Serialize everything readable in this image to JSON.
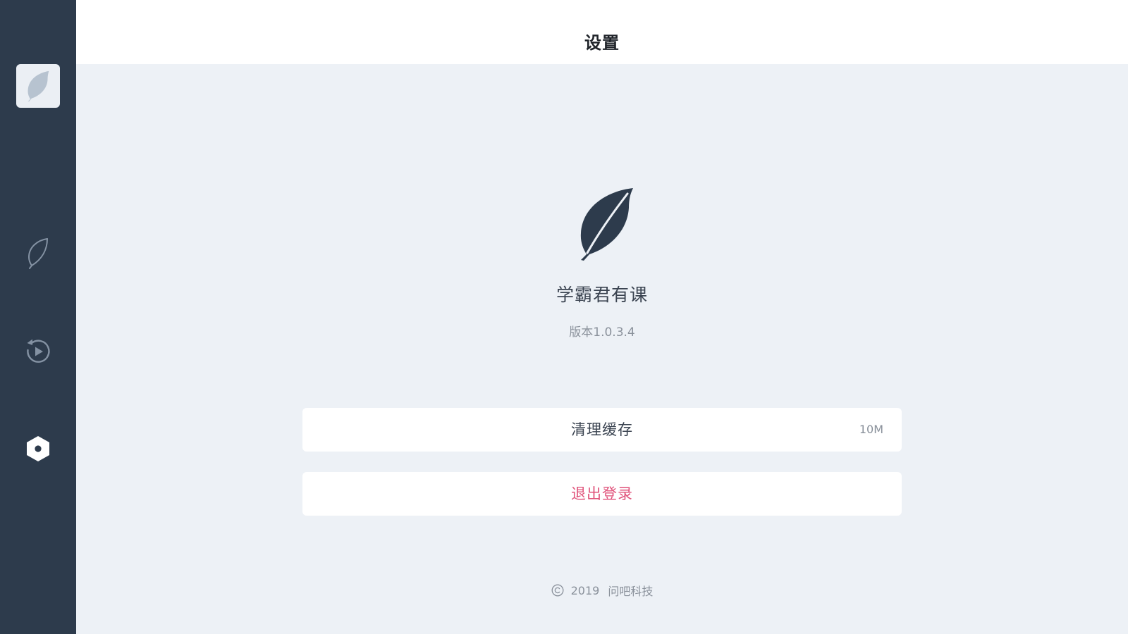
{
  "header": {
    "title": "设置"
  },
  "sidebar": {
    "items": [
      {
        "id": "logo",
        "icon": "leaf-logo-icon"
      },
      {
        "id": "course",
        "icon": "leaf-outline-icon"
      },
      {
        "id": "replay",
        "icon": "replay-icon"
      },
      {
        "id": "settings",
        "icon": "settings-hex-icon",
        "active": true
      }
    ]
  },
  "about": {
    "logo_icon": "leaf-logo-icon",
    "app_name": "学霸君有课",
    "version": "版本1.0.3.4"
  },
  "actions": {
    "clear_cache_label": "清理缓存",
    "cache_size": "10M",
    "logout_label": "退出登录"
  },
  "footer": {
    "copyright_icon": "copyright-icon",
    "year": "2019",
    "company": "问吧科技"
  },
  "colors": {
    "sidebar_bg": "#2d3b4c",
    "page_bg": "#edf1f6",
    "logout_text": "#e0527a",
    "logo": "#2d3b4c"
  }
}
